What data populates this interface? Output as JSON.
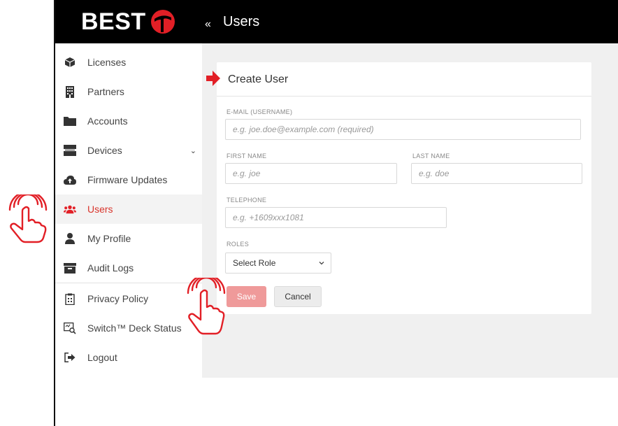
{
  "brand": {
    "name": "BEST",
    "accent": "#e21f26"
  },
  "header": {
    "collapse_glyph": "«",
    "title": "Users"
  },
  "sidebar": {
    "items": [
      {
        "label": "Licenses",
        "icon": "box-icon"
      },
      {
        "label": "Partners",
        "icon": "building-icon"
      },
      {
        "label": "Accounts",
        "icon": "folder-icon"
      },
      {
        "label": "Devices",
        "icon": "server-icon",
        "chevron": "⌄"
      },
      {
        "label": "Firmware Updates",
        "icon": "cloud-upload-icon"
      },
      {
        "label": "Users",
        "icon": "users-icon",
        "active": true
      },
      {
        "label": "My Profile",
        "icon": "user-icon"
      },
      {
        "label": "Audit Logs",
        "icon": "archive-icon"
      },
      {
        "label": "Privacy Policy",
        "icon": "clipboard-icon"
      },
      {
        "label": "Switch™ Deck Status",
        "icon": "screen-search-icon"
      },
      {
        "label": "Logout",
        "icon": "logout-icon"
      }
    ]
  },
  "form": {
    "title": "Create User",
    "email": {
      "label": "E-MAIL (USERNAME)",
      "placeholder": "e.g. joe.doe@example.com (required)",
      "value": ""
    },
    "first_name": {
      "label": "FIRST NAME",
      "placeholder": "e.g. joe",
      "value": ""
    },
    "last_name": {
      "label": "LAST NAME",
      "placeholder": "e.g. doe",
      "value": ""
    },
    "telephone": {
      "label": "TELEPHONE",
      "placeholder": "e.g. +1609xxx1081",
      "value": ""
    },
    "roles": {
      "label": "ROLES",
      "selected": "Select Role"
    },
    "save_label": "Save",
    "cancel_label": "Cancel"
  },
  "colors": {
    "accent": "#e21f26",
    "active_text": "#d9342b",
    "save_button": "#ef9a9a",
    "topbar": "#000000",
    "content_bg": "#f0f0f0"
  }
}
